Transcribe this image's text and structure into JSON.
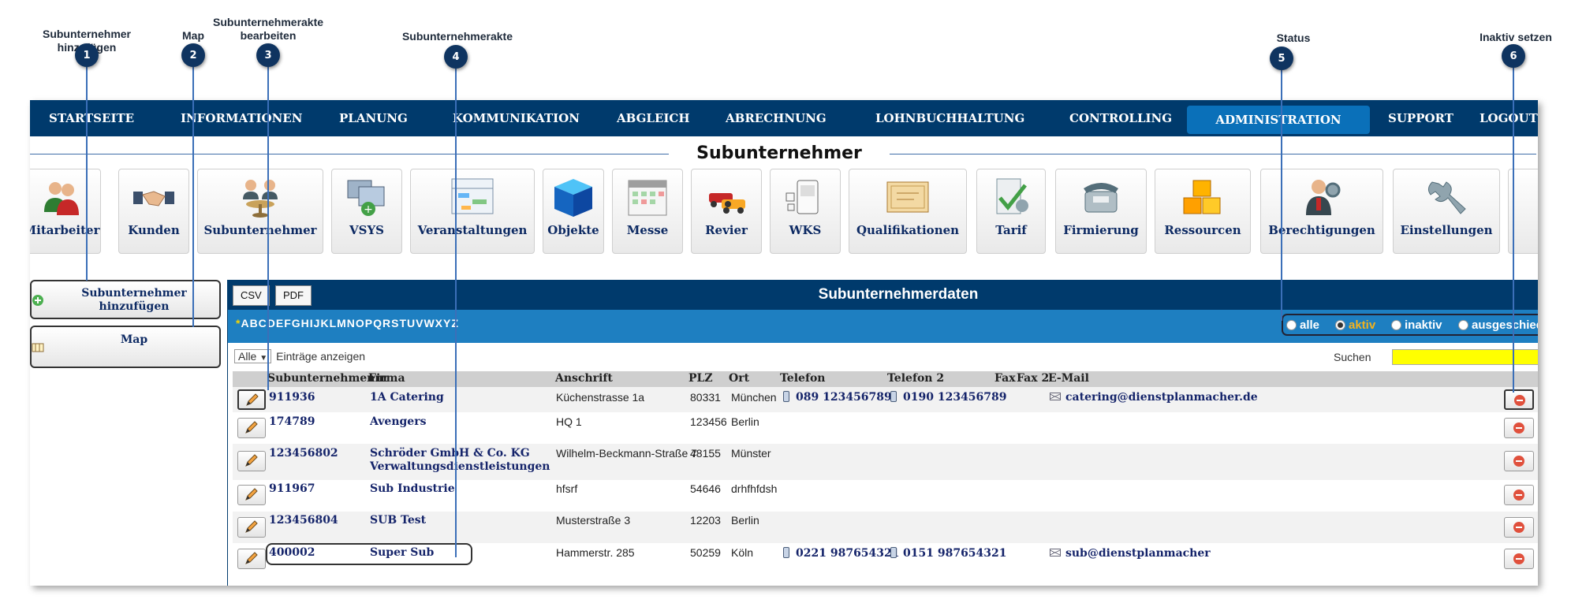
{
  "annotations": [
    {
      "num": "1",
      "label": "Subunternehmer hinzufügen"
    },
    {
      "num": "2",
      "label": "Map"
    },
    {
      "num": "3",
      "label": "Subunternehmerakte bearbeiten"
    },
    {
      "num": "4",
      "label": "Subunternehmerakte"
    },
    {
      "num": "5",
      "label": "Status"
    },
    {
      "num": "6",
      "label": "Inaktiv setzen"
    }
  ],
  "nav": [
    "STARTSEITE",
    "INFORMATIONEN",
    "PLANUNG",
    "KOMMUNIKATION",
    "ABGLEICH",
    "ABRECHNUNG",
    "LOHNBUCHHALTUNG",
    "CONTROLLING",
    "ADMINISTRATION",
    "SUPPORT",
    "LOGOUT"
  ],
  "nav_active": "ADMINISTRATION",
  "section_title": "Subunternehmer",
  "modules": [
    {
      "label": "Mitarbeiter",
      "icon": "employees-icon"
    },
    {
      "label": "Kunden",
      "icon": "handshake-icon"
    },
    {
      "label": "Subunternehmer",
      "icon": "subcontractor-icon"
    },
    {
      "label": "VSYS",
      "icon": "monitors-icon"
    },
    {
      "label": "Veranstaltungen",
      "icon": "event-plan-icon"
    },
    {
      "label": "Objekte",
      "icon": "cube-icon"
    },
    {
      "label": "Messe",
      "icon": "calendar-icon"
    },
    {
      "label": "Revier",
      "icon": "cars-icon"
    },
    {
      "label": "WKS",
      "icon": "nfc-device-icon"
    },
    {
      "label": "Qualifikationen",
      "icon": "certificate-icon"
    },
    {
      "label": "Tarif",
      "icon": "tariff-icon"
    },
    {
      "label": "Firmierung",
      "icon": "telephone-icon"
    },
    {
      "label": "Ressourcen",
      "icon": "boxes-icon"
    },
    {
      "label": "Berechtigungen",
      "icon": "user-gear-icon"
    },
    {
      "label": "Einstellungen",
      "icon": "wrench-icon"
    }
  ],
  "sidebar": {
    "add_label": "Subunternehmer hinzufügen",
    "map_label": "Map"
  },
  "panel": {
    "csv": "CSV",
    "pdf": "PDF",
    "title": "Subunternehmerdaten",
    "letters_star": "*",
    "letters": "ABCDEFGHIJKLMNOPQRSTUVWXYZ",
    "status_options": [
      "alle",
      "aktiv",
      "inaktiv",
      "ausgeschieden"
    ],
    "status_selected": "aktiv",
    "length_value": "Alle",
    "length_label": "Einträge anzeigen",
    "search_label": "Suchen",
    "search_value": ""
  },
  "table": {
    "columns": [
      "Subunternehmennr",
      "Firma",
      "Anschrift",
      "PLZ",
      "Ort",
      "Telefon",
      "Telefon 2",
      "Fax",
      "Fax 2",
      "E-Mail"
    ],
    "rows": [
      {
        "nr": "911936",
        "firma": "1A Catering",
        "firma2": "",
        "anschrift": "Küchenstrasse 1a",
        "plz": "80331",
        "ort": "München",
        "tel": "089 123456789",
        "tel2": "0190 123456789",
        "email": "catering@dienstplanmacher.de"
      },
      {
        "nr": "174789",
        "firma": "Avengers",
        "firma2": "",
        "anschrift": "HQ 1",
        "plz": "123456",
        "ort": "Berlin",
        "tel": "",
        "tel2": "",
        "email": ""
      },
      {
        "nr": "123456802",
        "firma": "Schröder GmbH & Co. KG",
        "firma2": "Verwaltungsdienstleistungen",
        "anschrift": "Wilhelm-Beckmann-Straße 7",
        "plz": "48155",
        "ort": "Münster",
        "tel": "",
        "tel2": "",
        "email": ""
      },
      {
        "nr": "911967",
        "firma": "Sub Industrie",
        "firma2": "",
        "anschrift": "hfsrf",
        "plz": "54646",
        "ort": "drhfhfdsh",
        "tel": "",
        "tel2": "",
        "email": ""
      },
      {
        "nr": "123456804",
        "firma": "SUB Test",
        "firma2": "",
        "anschrift": "Musterstraße 3",
        "plz": "12203",
        "ort": "Berlin",
        "tel": "",
        "tel2": "",
        "email": ""
      },
      {
        "nr": "400002",
        "firma": "Super Sub",
        "firma2": "",
        "anschrift": "Hammerstr. 285",
        "plz": "50259",
        "ort": "Köln",
        "tel": "0221 987654321",
        "tel2": "0151 987654321",
        "email": "sub@dienstplanmacher"
      }
    ]
  },
  "colors": {
    "nav_bg": "#003a6c",
    "nav_active": "#0a70b9",
    "alpha_bar": "#1e7fc1",
    "annotation_bubble": "#0f3460",
    "leader_line": "#3b6fb8",
    "search_bg": "#ffff00",
    "status_selected": "#f5b21b"
  }
}
